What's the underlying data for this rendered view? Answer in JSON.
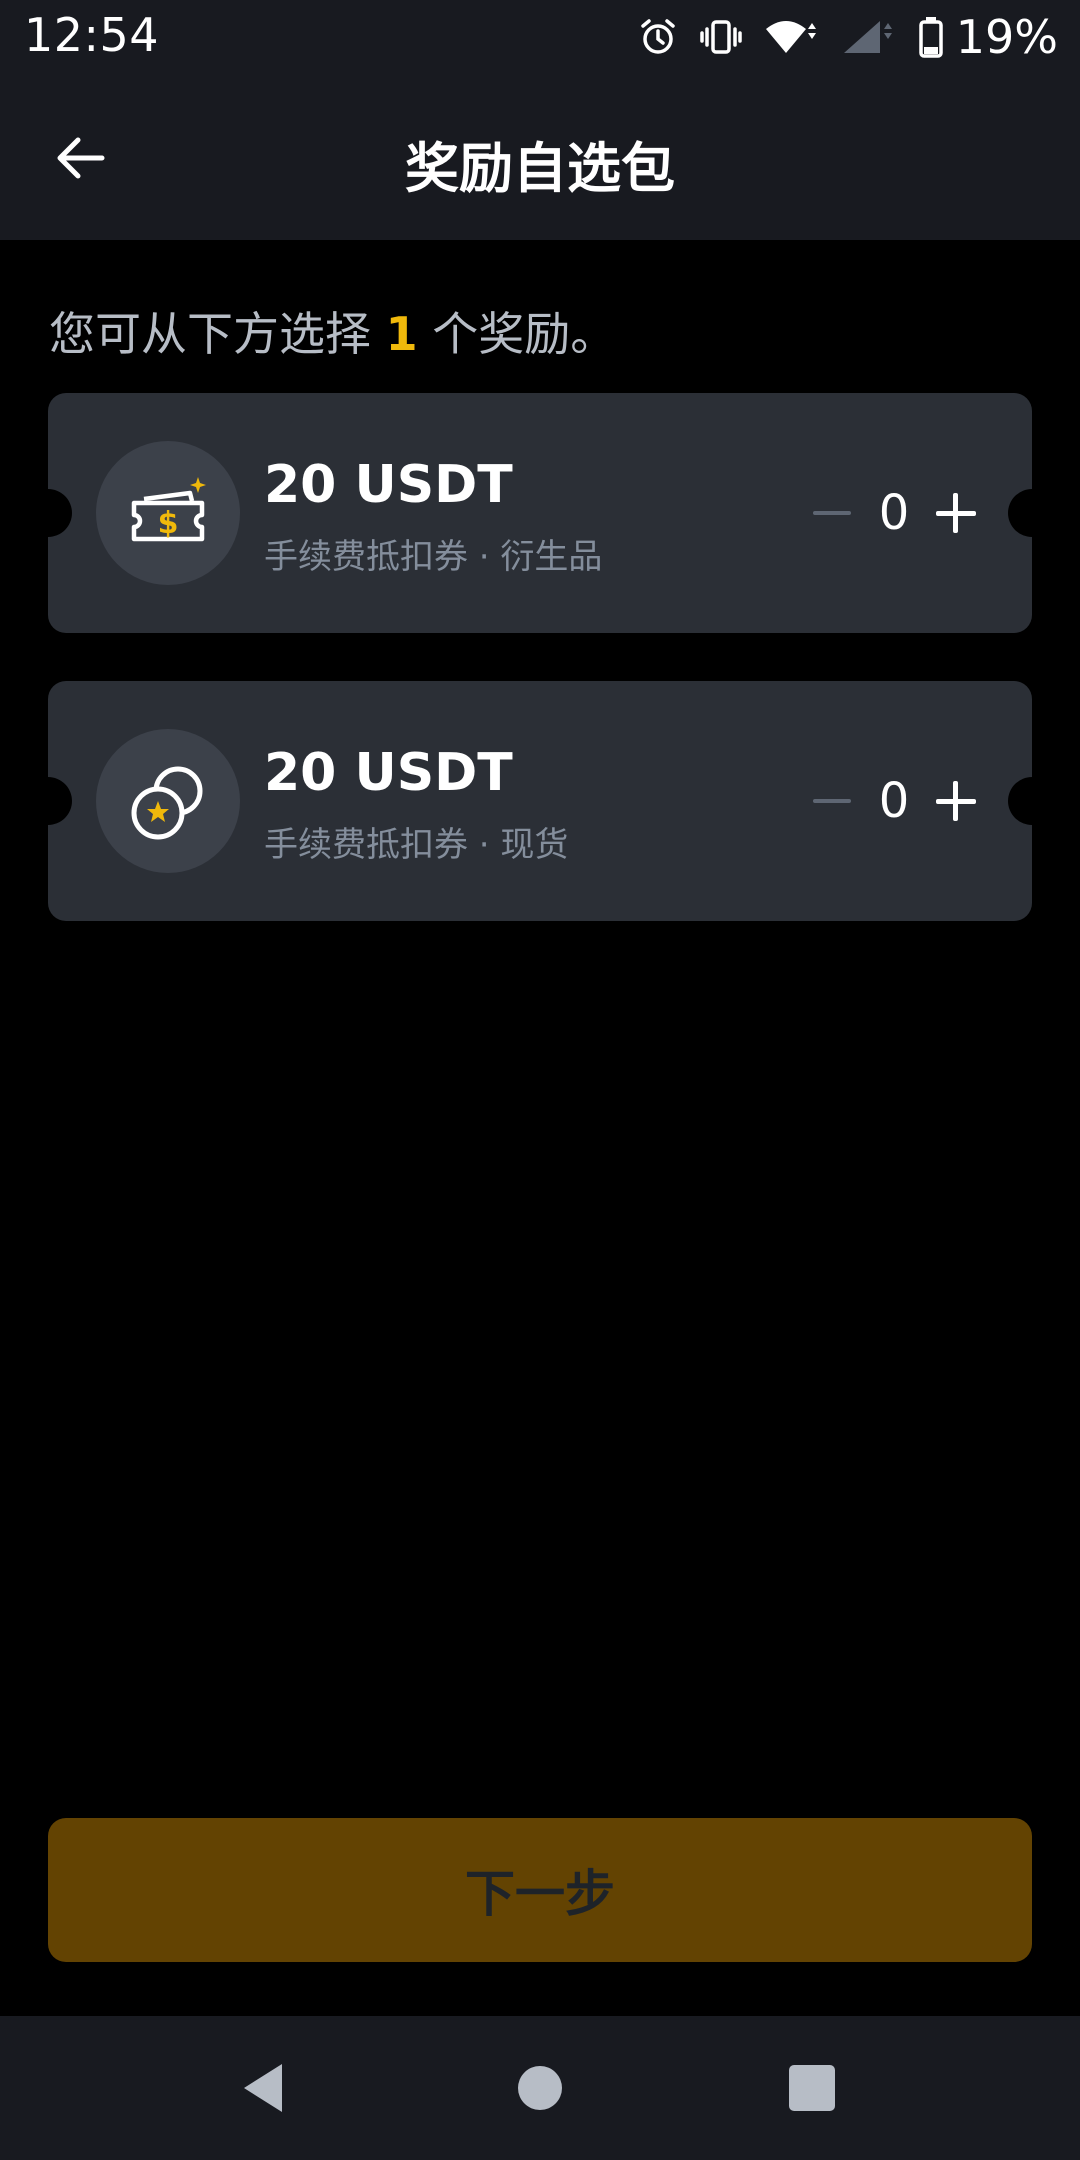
{
  "status_bar": {
    "time": "12:54",
    "battery": "19%",
    "icons": [
      "alarm-icon",
      "vibrate-icon",
      "wifi-icon",
      "cell-signal-icon",
      "battery-icon"
    ]
  },
  "header": {
    "title": "奖励自选包",
    "back_icon": "arrow-left-icon"
  },
  "instruction": {
    "prefix": "您可从下方选择",
    "count": "1",
    "suffix": "个奖励。"
  },
  "rewards": [
    {
      "amount": "20 USDT",
      "desc": "手续费抵扣券 · 衍生品",
      "icon": "ticket-dollar-icon",
      "quantity": "0"
    },
    {
      "amount": "20 USDT",
      "desc": "手续费抵扣券 · 现货",
      "icon": "coins-star-icon",
      "quantity": "0"
    }
  ],
  "next_button": {
    "label": "下一步"
  },
  "nav": {
    "icons": [
      "back-triangle-icon",
      "home-circle-icon",
      "recents-square-icon"
    ]
  },
  "colors": {
    "accent": "#F0B90B",
    "card": "#2B2F36",
    "button_disabled": "#634302"
  }
}
